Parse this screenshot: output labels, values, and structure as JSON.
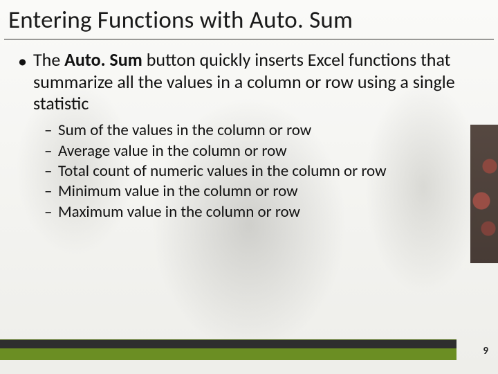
{
  "title": "Entering Functions with Auto. Sum",
  "main_bullet": {
    "prefix": "The ",
    "bold": "Auto. Sum",
    "suffix": " button quickly inserts Excel functions that summarize all the values in a column or row using a single statistic"
  },
  "sub_bullets": [
    "Sum of the values in the column or row",
    "Average value in the column or row",
    "Total count of numeric values in the column or row",
    "Minimum value in the column or row",
    "Maximum value in the column or row"
  ],
  "page_number": "9",
  "colors": {
    "accent_bar": "#6b8e23"
  }
}
